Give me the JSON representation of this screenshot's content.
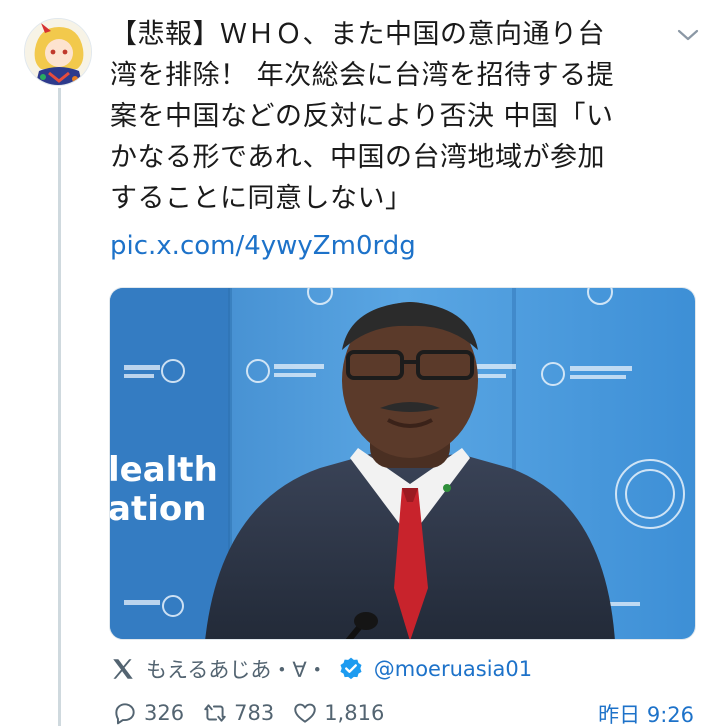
{
  "tweet": {
    "lines": [
      "【悲報】ＷＨＯ、また中国の意向通り台",
      "湾を排除！ 年次総会に台湾を招待する提",
      "案を中国などの反対により否決 中国「い",
      "かなる形であれ、中国の台湾地域が参加",
      "することに同意しない」"
    ],
    "link": "pic.x.com/4ywyZm0rdg"
  },
  "media": {
    "backdrop_left_text": [
      "lealth",
      "ation"
    ],
    "colors": {
      "backdrop": "#3d8fd6",
      "backdrop_light": "#5aa6e3",
      "suit": "#2b3345",
      "tie": "#c8232c"
    }
  },
  "author": {
    "name": "もえるあじあ・∀・",
    "handle": "@moeruasia01"
  },
  "stats": {
    "replies": "326",
    "retweets": "783",
    "likes": "1,816"
  },
  "timestamp": "昨日 9:26",
  "icons": [
    "chevron-down-icon",
    "x-logo-icon",
    "verified-badge-icon",
    "reply-icon",
    "retweet-icon",
    "like-icon"
  ]
}
